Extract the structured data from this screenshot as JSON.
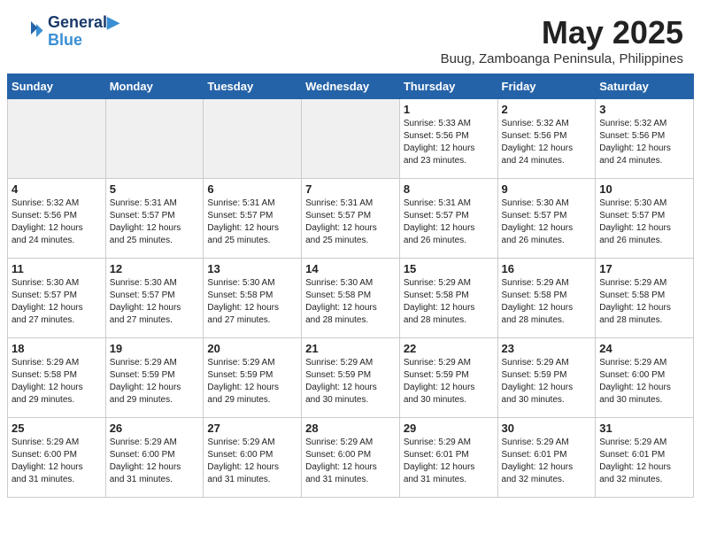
{
  "header": {
    "logo_line1": "General",
    "logo_line2": "Blue",
    "month_title": "May 2025",
    "location": "Buug, Zamboanga Peninsula, Philippines"
  },
  "weekdays": [
    "Sunday",
    "Monday",
    "Tuesday",
    "Wednesday",
    "Thursday",
    "Friday",
    "Saturday"
  ],
  "weeks": [
    [
      {
        "day": "",
        "info": ""
      },
      {
        "day": "",
        "info": ""
      },
      {
        "day": "",
        "info": ""
      },
      {
        "day": "",
        "info": ""
      },
      {
        "day": "1",
        "info": "Sunrise: 5:33 AM\nSunset: 5:56 PM\nDaylight: 12 hours\nand 23 minutes."
      },
      {
        "day": "2",
        "info": "Sunrise: 5:32 AM\nSunset: 5:56 PM\nDaylight: 12 hours\nand 24 minutes."
      },
      {
        "day": "3",
        "info": "Sunrise: 5:32 AM\nSunset: 5:56 PM\nDaylight: 12 hours\nand 24 minutes."
      }
    ],
    [
      {
        "day": "4",
        "info": "Sunrise: 5:32 AM\nSunset: 5:56 PM\nDaylight: 12 hours\nand 24 minutes."
      },
      {
        "day": "5",
        "info": "Sunrise: 5:31 AM\nSunset: 5:57 PM\nDaylight: 12 hours\nand 25 minutes."
      },
      {
        "day": "6",
        "info": "Sunrise: 5:31 AM\nSunset: 5:57 PM\nDaylight: 12 hours\nand 25 minutes."
      },
      {
        "day": "7",
        "info": "Sunrise: 5:31 AM\nSunset: 5:57 PM\nDaylight: 12 hours\nand 25 minutes."
      },
      {
        "day": "8",
        "info": "Sunrise: 5:31 AM\nSunset: 5:57 PM\nDaylight: 12 hours\nand 26 minutes."
      },
      {
        "day": "9",
        "info": "Sunrise: 5:30 AM\nSunset: 5:57 PM\nDaylight: 12 hours\nand 26 minutes."
      },
      {
        "day": "10",
        "info": "Sunrise: 5:30 AM\nSunset: 5:57 PM\nDaylight: 12 hours\nand 26 minutes."
      }
    ],
    [
      {
        "day": "11",
        "info": "Sunrise: 5:30 AM\nSunset: 5:57 PM\nDaylight: 12 hours\nand 27 minutes."
      },
      {
        "day": "12",
        "info": "Sunrise: 5:30 AM\nSunset: 5:57 PM\nDaylight: 12 hours\nand 27 minutes."
      },
      {
        "day": "13",
        "info": "Sunrise: 5:30 AM\nSunset: 5:58 PM\nDaylight: 12 hours\nand 27 minutes."
      },
      {
        "day": "14",
        "info": "Sunrise: 5:30 AM\nSunset: 5:58 PM\nDaylight: 12 hours\nand 28 minutes."
      },
      {
        "day": "15",
        "info": "Sunrise: 5:29 AM\nSunset: 5:58 PM\nDaylight: 12 hours\nand 28 minutes."
      },
      {
        "day": "16",
        "info": "Sunrise: 5:29 AM\nSunset: 5:58 PM\nDaylight: 12 hours\nand 28 minutes."
      },
      {
        "day": "17",
        "info": "Sunrise: 5:29 AM\nSunset: 5:58 PM\nDaylight: 12 hours\nand 28 minutes."
      }
    ],
    [
      {
        "day": "18",
        "info": "Sunrise: 5:29 AM\nSunset: 5:58 PM\nDaylight: 12 hours\nand 29 minutes."
      },
      {
        "day": "19",
        "info": "Sunrise: 5:29 AM\nSunset: 5:59 PM\nDaylight: 12 hours\nand 29 minutes."
      },
      {
        "day": "20",
        "info": "Sunrise: 5:29 AM\nSunset: 5:59 PM\nDaylight: 12 hours\nand 29 minutes."
      },
      {
        "day": "21",
        "info": "Sunrise: 5:29 AM\nSunset: 5:59 PM\nDaylight: 12 hours\nand 30 minutes."
      },
      {
        "day": "22",
        "info": "Sunrise: 5:29 AM\nSunset: 5:59 PM\nDaylight: 12 hours\nand 30 minutes."
      },
      {
        "day": "23",
        "info": "Sunrise: 5:29 AM\nSunset: 5:59 PM\nDaylight: 12 hours\nand 30 minutes."
      },
      {
        "day": "24",
        "info": "Sunrise: 5:29 AM\nSunset: 6:00 PM\nDaylight: 12 hours\nand 30 minutes."
      }
    ],
    [
      {
        "day": "25",
        "info": "Sunrise: 5:29 AM\nSunset: 6:00 PM\nDaylight: 12 hours\nand 31 minutes."
      },
      {
        "day": "26",
        "info": "Sunrise: 5:29 AM\nSunset: 6:00 PM\nDaylight: 12 hours\nand 31 minutes."
      },
      {
        "day": "27",
        "info": "Sunrise: 5:29 AM\nSunset: 6:00 PM\nDaylight: 12 hours\nand 31 minutes."
      },
      {
        "day": "28",
        "info": "Sunrise: 5:29 AM\nSunset: 6:00 PM\nDaylight: 12 hours\nand 31 minutes."
      },
      {
        "day": "29",
        "info": "Sunrise: 5:29 AM\nSunset: 6:01 PM\nDaylight: 12 hours\nand 31 minutes."
      },
      {
        "day": "30",
        "info": "Sunrise: 5:29 AM\nSunset: 6:01 PM\nDaylight: 12 hours\nand 32 minutes."
      },
      {
        "day": "31",
        "info": "Sunrise: 5:29 AM\nSunset: 6:01 PM\nDaylight: 12 hours\nand 32 minutes."
      }
    ]
  ]
}
